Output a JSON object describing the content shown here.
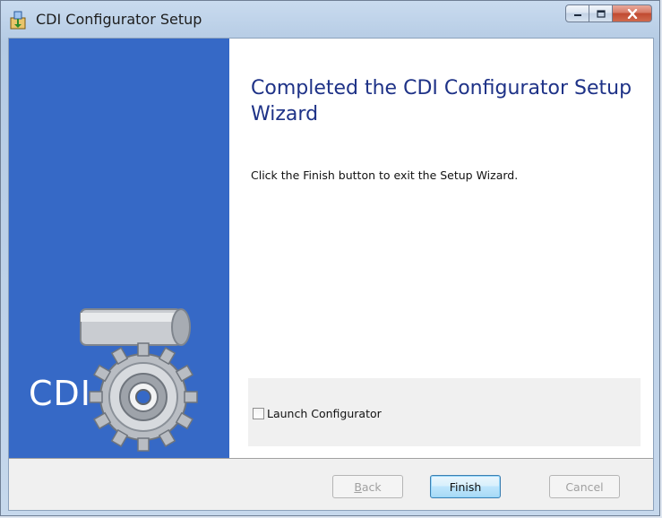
{
  "window": {
    "title": "CDI Configurator Setup",
    "icon": "installer-icon",
    "controls": {
      "minimize": "minimize-icon",
      "maximize": "maximize-icon",
      "close": "close-icon"
    }
  },
  "side_panel": {
    "logo_text": "CDI",
    "color": "#3669c6"
  },
  "main": {
    "heading": "Completed the CDI Configurator Setup Wizard",
    "body": "Click the Finish button to exit the Setup Wizard.",
    "launch_checkbox": {
      "label": "Launch Configurator",
      "checked": false
    }
  },
  "buttons": {
    "back": {
      "prefix": "",
      "accel": "B",
      "rest": "ack",
      "enabled": false
    },
    "finish": {
      "label": "Finish",
      "enabled": true
    },
    "cancel": {
      "label": "Cancel",
      "enabled": false
    }
  },
  "colors": {
    "heading": "#1e3287",
    "accent": "#3669c6"
  }
}
